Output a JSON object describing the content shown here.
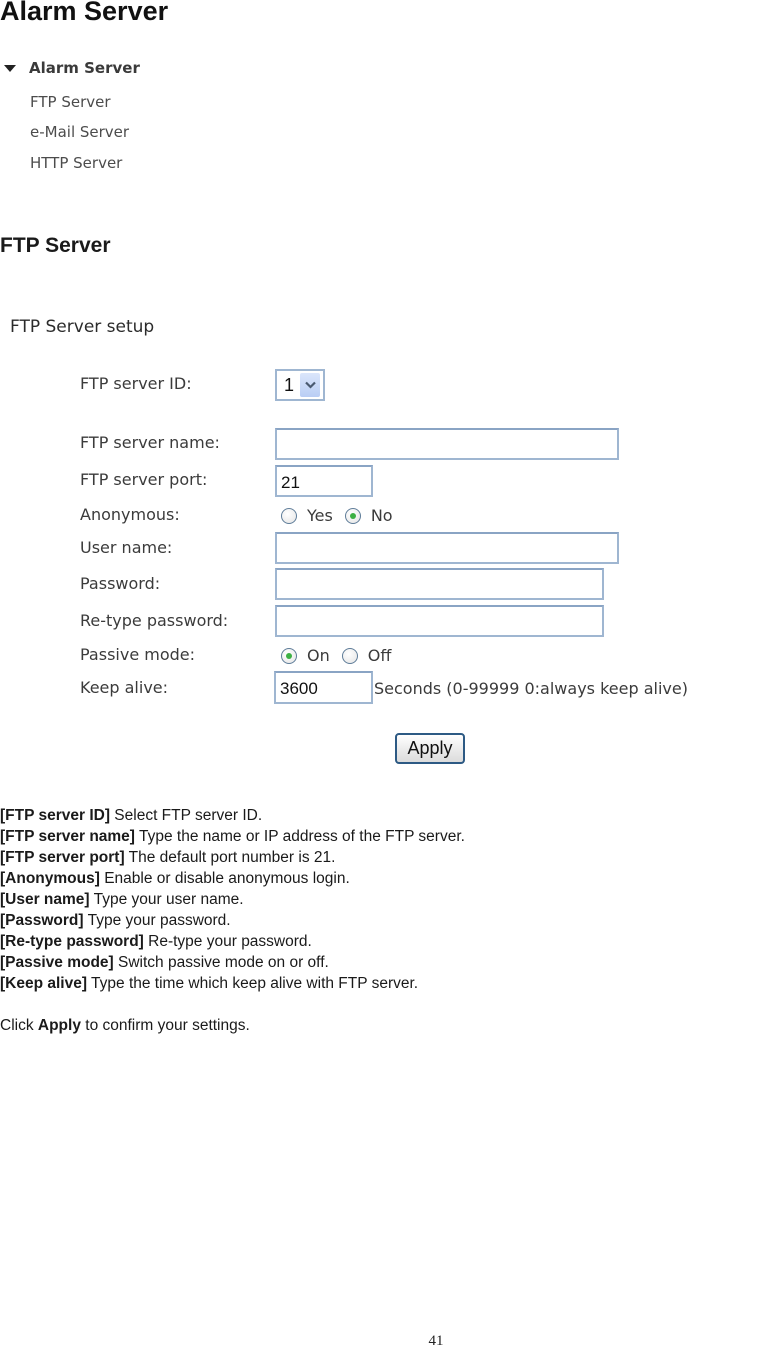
{
  "page_title": "Alarm Server",
  "menu": {
    "header": "Alarm Server",
    "items": [
      {
        "label": "FTP Server"
      },
      {
        "label": "e-Mail Server"
      },
      {
        "label": "HTTP Server"
      }
    ]
  },
  "section_title": "FTP Server",
  "form": {
    "title": "FTP Server setup",
    "server_id": {
      "label": "FTP server ID:",
      "value": "1"
    },
    "server_name": {
      "label": "FTP server name:",
      "value": ""
    },
    "server_port": {
      "label": "FTP server port:",
      "value": "21"
    },
    "anonymous": {
      "label": "Anonymous:",
      "options": [
        "Yes",
        "No"
      ],
      "selected": "No"
    },
    "user_name": {
      "label": "User name:",
      "value": ""
    },
    "password": {
      "label": "Password:",
      "value": ""
    },
    "retype_password": {
      "label": "Re-type password:",
      "value": ""
    },
    "passive_mode": {
      "label": "Passive mode:",
      "options": [
        "On",
        "Off"
      ],
      "selected": "On"
    },
    "keep_alive": {
      "label": "Keep alive:",
      "value": "3600",
      "hint": "Seconds (0-99999 0:always keep alive)"
    },
    "apply_label": "Apply"
  },
  "descriptions": [
    {
      "term": "[FTP server ID]",
      "text": " Select FTP server ID."
    },
    {
      "term": "[FTP server name]",
      "text": " Type the name or IP address of the FTP server."
    },
    {
      "term": "[FTP server port]",
      "text": " The default port number is 21."
    },
    {
      "term": "[Anonymous]",
      "text": " Enable or disable anonymous login."
    },
    {
      "term": "[User name]",
      "text": " Type your user name."
    },
    {
      "term": "[Password]",
      "text": " Type your password."
    },
    {
      "term": "[Re-type password]",
      "text": " Re-type your password."
    },
    {
      "term": "[Passive mode]",
      "text": " Switch passive mode on or off."
    },
    {
      "term": "[Keep alive]",
      "text": " Type the time which keep alive with FTP server."
    }
  ],
  "click_note": {
    "prefix": "Click ",
    "bold": "Apply",
    "suffix": " to confirm your settings."
  },
  "page_number": "41"
}
